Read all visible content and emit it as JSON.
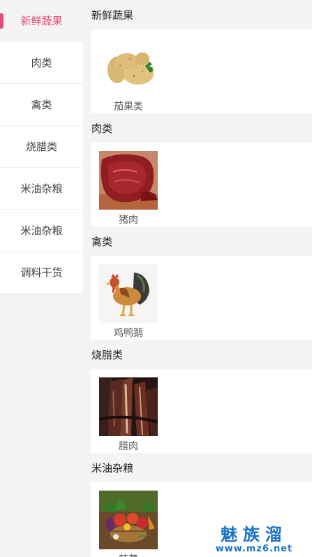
{
  "sidebar": {
    "items": [
      {
        "label": "新鲜蔬果",
        "active": true
      },
      {
        "label": "肉类",
        "active": false
      },
      {
        "label": "禽类",
        "active": false
      },
      {
        "label": "烧腊类",
        "active": false
      },
      {
        "label": "米油杂粮",
        "active": false
      },
      {
        "label": "米油杂粮",
        "active": false
      },
      {
        "label": "调料干货",
        "active": false
      }
    ]
  },
  "sections": [
    {
      "title": "新鲜蔬果",
      "product": {
        "label": "茄果类",
        "image": "potatoes-image"
      }
    },
    {
      "title": "肉类",
      "product": {
        "label": "猪肉",
        "image": "raw-beef-image"
      }
    },
    {
      "title": "禽类",
      "product": {
        "label": "鸡鸭鹅",
        "image": "rooster-image"
      }
    },
    {
      "title": "烧腊类",
      "product": {
        "label": "腊肉",
        "image": "cured-meat-image"
      }
    },
    {
      "title": "米油杂粮",
      "product": {
        "label": "蔬菜",
        "image": "vegetable-basket-image"
      }
    }
  ],
  "watermark": {
    "main": "魅族溜",
    "url": "www.mz6.net"
  },
  "colors": {
    "accent": "#e0507a",
    "background": "#f4f4f4",
    "card": "#ffffff",
    "watermark": "#1a73c8"
  }
}
